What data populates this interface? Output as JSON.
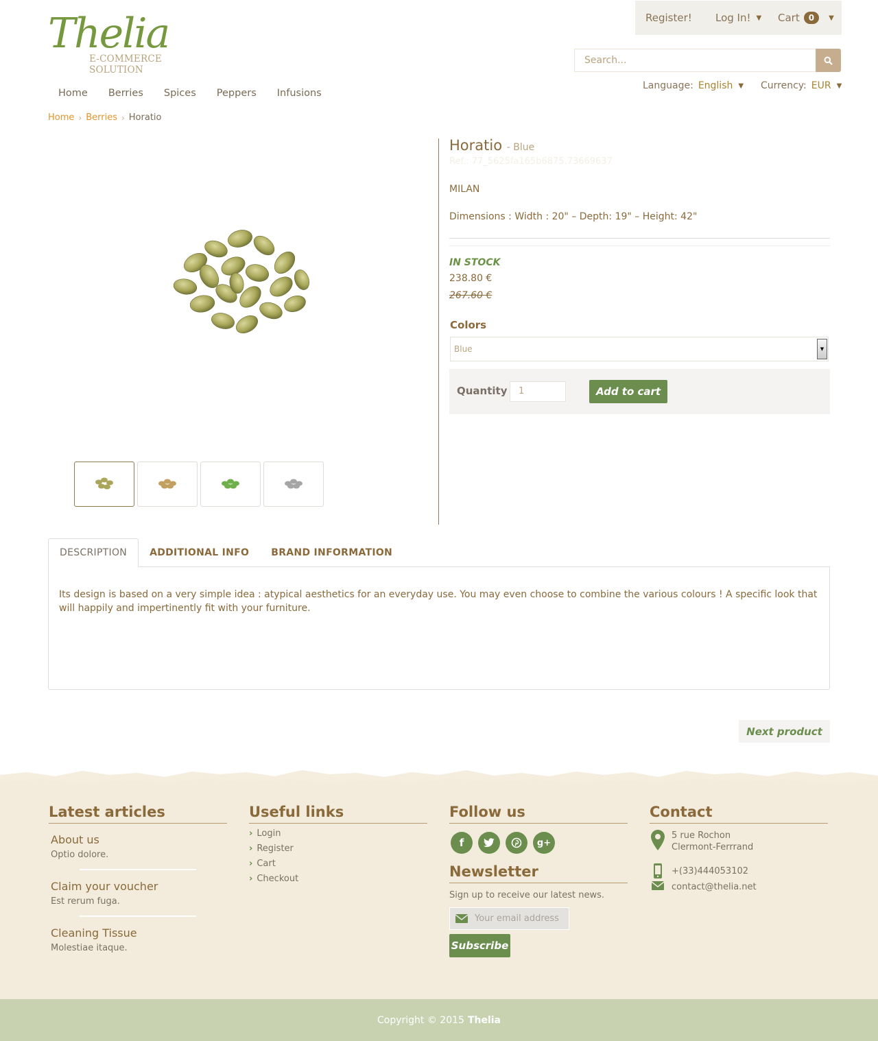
{
  "logo": {
    "name": "Thelia",
    "tagline": "E-COMMERCE SOLUTION"
  },
  "topbar": {
    "register": "Register!",
    "login": "Log In!",
    "cart": "Cart",
    "cart_count": "0"
  },
  "search": {
    "placeholder": "Search..."
  },
  "prefs": {
    "language_label": "Language:",
    "language_value": "English",
    "currency_label": "Currency:",
    "currency_value": "EUR"
  },
  "nav": {
    "items": [
      "Home",
      "Berries",
      "Spices",
      "Peppers",
      "Infusions"
    ]
  },
  "breadcrumb": {
    "home": "Home",
    "category": "Berries",
    "current": "Horatio"
  },
  "product": {
    "title": "Horatio",
    "variant": "- Blue",
    "ref": "Ref.: 77_5625fa165b6875.73669637",
    "brand": "MILAN",
    "dimensions": "Dimensions : Width : 20\" – Depth: 19\" – Height: 42\"",
    "stock": "IN STOCK",
    "price": "238.80 €",
    "old_price": "267.60 €",
    "colors_label": "Colors",
    "color_selected": "Blue",
    "quantity_label": "Quantity",
    "quantity_value": "1",
    "add_to_cart": "Add to cart"
  },
  "tabs": {
    "items": [
      "DESCRIPTION",
      "ADDITIONAL INFO",
      "BRAND INFORMATION"
    ],
    "description": "Its design is based on a very simple idea : atypical aesthetics for an everyday use. You may even choose to combine the various colours ! A specific look that will happily and impertinently fit with your furniture."
  },
  "next_product": "Next product",
  "footer": {
    "articles_title": "Latest articles",
    "articles": [
      {
        "title": "About us",
        "desc": "Optio dolore."
      },
      {
        "title": "Claim your voucher",
        "desc": "Est rerum fuga."
      },
      {
        "title": "Cleaning Tissue",
        "desc": "Molestiae itaque."
      }
    ],
    "links_title": "Useful links",
    "links": [
      "Login",
      "Register",
      "Cart",
      "Checkout"
    ],
    "follow_title": "Follow us",
    "newsletter_title": "Newsletter",
    "newsletter_text": "Sign up to receive our latest news.",
    "email_placeholder": "Your email address",
    "subscribe": "Subscribe",
    "contact_title": "Contact",
    "address_line1": "5 rue Rochon",
    "address_line2": "Clermont-Ferrrand",
    "phone": "+(33)444053102",
    "email": "contact@thelia.net"
  },
  "copyright": {
    "text": "Copyright © 2015",
    "brand": "Thelia"
  },
  "colors": {
    "accent_green": "#6b8e4e",
    "brown": "#8a6a3b",
    "breadcrumb_orange": "#e4952b",
    "footer_bg": "#f3ebdb",
    "copyright_bg": "#c8d2b0"
  }
}
